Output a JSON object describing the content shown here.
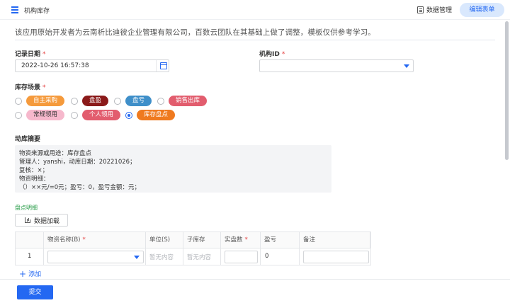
{
  "header": {
    "title": "机构库存",
    "data_mgmt_label": "数据管理",
    "edit_form_label": "编辑表单"
  },
  "notice": "该应用原始开发者为云南析比迪彼企业管理有限公司，百数云团队在其基础上做了调整，模板仅供参考学习。",
  "form": {
    "date_label": "记录日期",
    "date_value": "2022-10-26 16:57:38",
    "org_label": "机构ID",
    "org_value": "",
    "scene_label": "库存场景",
    "required_mark": "*",
    "scene_options": [
      {
        "label": "自主采购",
        "color": "#f59a3c",
        "checked": false
      },
      {
        "label": "盘盈",
        "color": "#8b1a1a",
        "checked": false
      },
      {
        "label": "盘亏",
        "color": "#3f8fc9",
        "checked": false
      },
      {
        "label": "销售出库",
        "color": "#e25d6e",
        "checked": false
      },
      {
        "label": "常规领用",
        "color": "#f6b8cc",
        "checked": false,
        "text_color": "#333"
      },
      {
        "label": "个人领用",
        "color": "#e25d6e",
        "checked": false
      },
      {
        "label": "库存盘点",
        "color": "#ef7a1f",
        "checked": true
      }
    ],
    "summary_label": "动库摘要",
    "summary_lines": [
      "物资来源或用途：库存盘点",
      "管理人：yanshi，动库日期：20221026；",
      "复核：×；",
      "物资明细：",
      "（）××元/=0元；盈亏：0，盈亏金额：元；"
    ]
  },
  "detail": {
    "section_label": "盘点明细",
    "load_button_label": "数据加载",
    "columns": [
      "",
      "物资名称(B)",
      "单位(S)",
      "子库存",
      "实盘数",
      "盈亏",
      "备注"
    ],
    "rows": [
      {
        "index": "1",
        "item_name": "",
        "unit_placeholder": "暂无内容",
        "sub_stock_placeholder": "暂无内容",
        "actual_count": "",
        "profit_loss": "0",
        "remark": ""
      }
    ],
    "add_label": "添加"
  },
  "footer": {
    "submit_label": "提交"
  },
  "colors": {
    "accent": "#2468f2",
    "required": "#e43f3f"
  }
}
